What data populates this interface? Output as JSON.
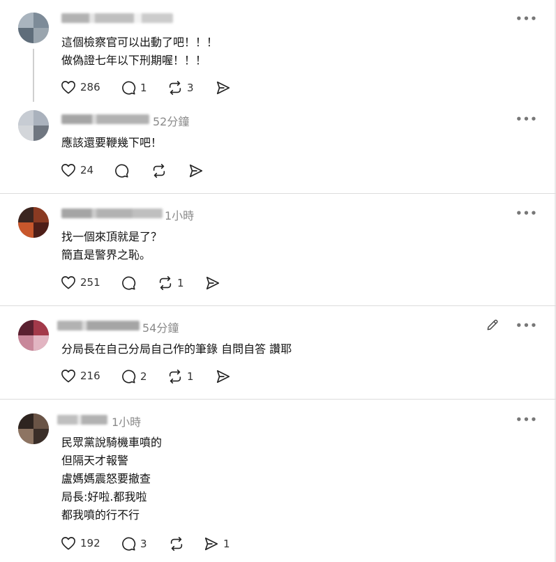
{
  "comments": [
    {
      "time": "",
      "lines": [
        "這個檢察官可以出動了吧！！！",
        "做偽證七年以下刑期喔！！！"
      ],
      "likes": "286",
      "replies": "1",
      "reposts": "3",
      "shares": ""
    },
    {
      "time": "52分鐘",
      "lines": [
        "應該還要鞭幾下吧！"
      ],
      "likes": "24",
      "replies": "",
      "reposts": "",
      "shares": ""
    },
    {
      "time": "1小時",
      "lines": [
        "找一個來頂就是了？",
        "簡直是警界之恥。"
      ],
      "likes": "251",
      "replies": "",
      "reposts": "1",
      "shares": ""
    },
    {
      "time": "54分鐘",
      "lines": [
        "分局長在自己分局自己作的筆錄 自問自答 讚耶"
      ],
      "likes": "216",
      "replies": "2",
      "reposts": "1",
      "shares": ""
    },
    {
      "time": "1小時",
      "lines": [
        "民眾黨說騎機車噴的",
        "但隔天才報警",
        "盧媽媽震怒要撤查",
        "局長:好啦.都我啦",
        "都我噴的行不行"
      ],
      "likes": "192",
      "replies": "3",
      "reposts": "",
      "shares": "1"
    }
  ],
  "ui": {
    "more_label": "•••"
  },
  "icons": {
    "like": "heart-icon",
    "reply": "comment-icon",
    "repost": "repost-icon",
    "share": "send-icon",
    "edit": "pencil-icon",
    "more": "more-icon"
  },
  "colors": {
    "text": "#111111",
    "muted": "#8a8a8a",
    "icon": "#222222",
    "divider": "#dcdcdc"
  }
}
